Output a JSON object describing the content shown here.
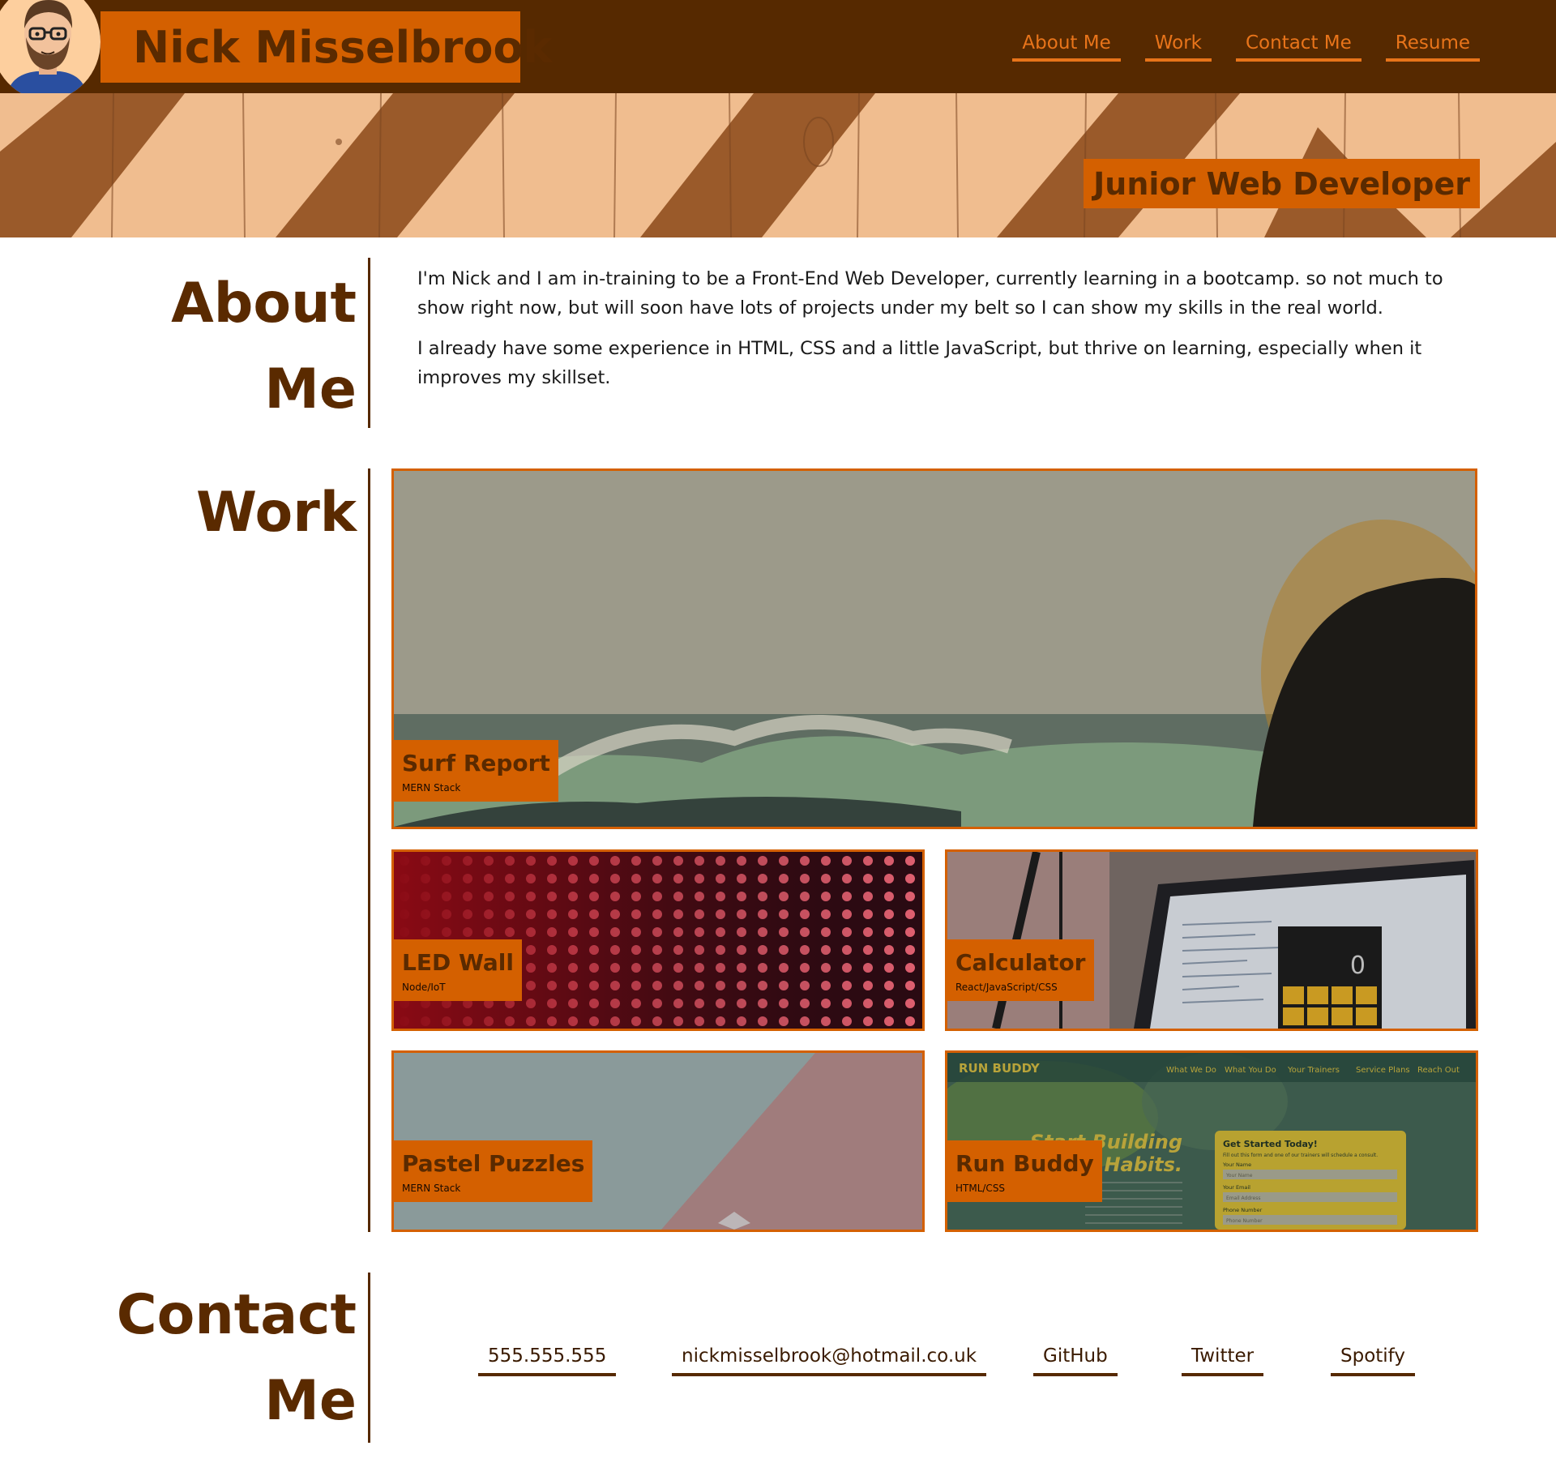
{
  "header": {
    "name": "Nick Misselbrook",
    "nav": [
      {
        "label": "About Me"
      },
      {
        "label": "Work"
      },
      {
        "label": "Contact Me"
      },
      {
        "label": "Resume"
      }
    ]
  },
  "hero": {
    "tagline": "Junior Web Developer"
  },
  "about": {
    "title_line1": "About",
    "title_line2": "Me",
    "paragraphs": [
      "I'm Nick and I am in-training to be a Front-End Web Developer, currently learning in a bootcamp. so not much to show right now, but will soon have lots of projects under my belt so I can show my skills in the real world.",
      "I already have some experience in HTML, CSS and a little JavaScript, but thrive on learning, especially when it improves my skillset."
    ]
  },
  "work": {
    "title": "Work",
    "projects": [
      {
        "title": "Surf Report",
        "stack": "MERN Stack"
      },
      {
        "title": "LED Wall",
        "stack": "Node/IoT"
      },
      {
        "title": "Calculator",
        "stack": "React/JavaScript/CSS"
      },
      {
        "title": "Pastel Puzzles",
        "stack": "MERN Stack"
      },
      {
        "title": "Run Buddy",
        "stack": "HTML/CSS"
      }
    ],
    "run_buddy_preview": {
      "brand": "RUN BUDDY",
      "nav": [
        "What We Do",
        "What You Do",
        "Your Trainers",
        "Service Plans",
        "Reach Out"
      ],
      "headline_1": "Start Building",
      "headline_2": "Habits.",
      "form_title": "Get Started Today!",
      "form_sub": "Fill out this form and one of our trainers will schedule a consult.",
      "field_1_label": "Your Name",
      "field_1_placeholder": "Your Name",
      "field_2_label": "Your Email",
      "field_2_placeholder": "Email Address",
      "field_3_label": "Phone Number",
      "field_3_placeholder": "Phone Number"
    },
    "calculator_display": "0"
  },
  "contact": {
    "title_line1": "Contact",
    "title_line2": "Me",
    "links": [
      {
        "label": "555.555.555"
      },
      {
        "label": "nickmisselbrook@hotmail.co.uk"
      },
      {
        "label": "GitHub"
      },
      {
        "label": "Twitter"
      },
      {
        "label": "Spotify"
      }
    ]
  },
  "colors": {
    "header_bg": "#562900",
    "accent": "#d46000",
    "nav_text": "#e8741a",
    "heading_text": "#5a2a00",
    "hero_light": "#f0bd8f",
    "hero_dark": "#9a5a2a"
  }
}
